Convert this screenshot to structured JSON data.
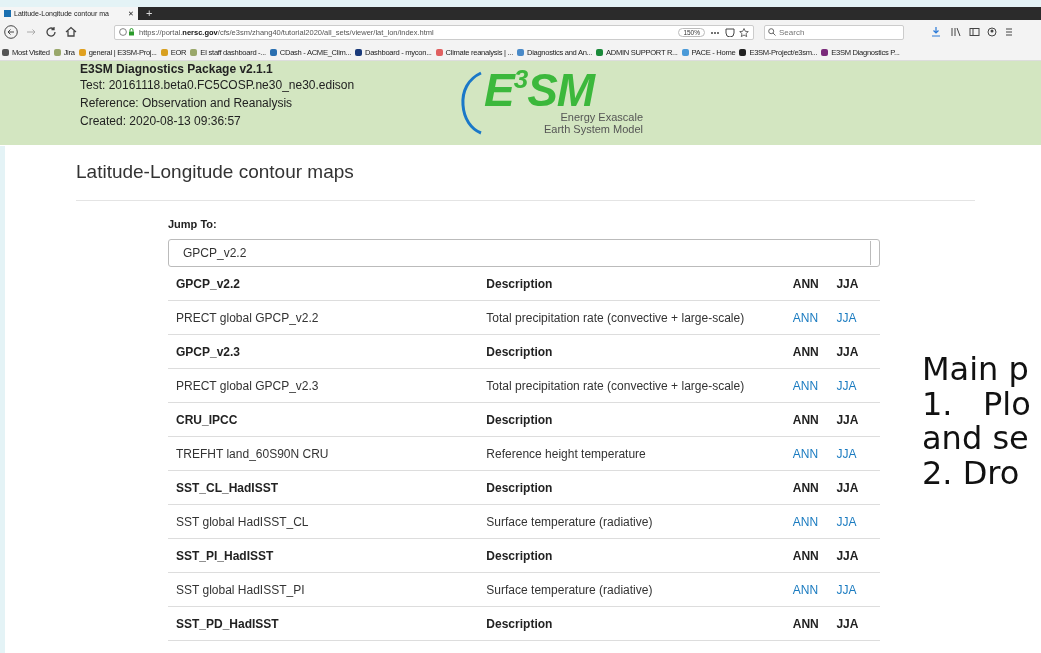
{
  "browser": {
    "tab": {
      "title": "Latitude-Longitude contour ma",
      "close": "✕"
    },
    "new_tab": "+",
    "url": {
      "prefix": "https://portal.",
      "domain": "nersc.gov",
      "path": "/cfs/e3sm/zhang40/tutorial2020/all_sets/viewer/lat_lon/index.html"
    },
    "zoom": "150%",
    "search": {
      "placeholder": "Search"
    },
    "bookmarks": [
      {
        "label": "Most Visited",
        "color": "#555555"
      },
      {
        "label": "Jira",
        "color": "#9aa86b"
      },
      {
        "label": "general | E3SM-Proj...",
        "color": "#e0a020"
      },
      {
        "label": "EOR",
        "color": "#d8a020"
      },
      {
        "label": "EI staff dashboard -...",
        "color": "#9aa86b"
      },
      {
        "label": "CDash - ACME_Clim...",
        "color": "#2a6fb0"
      },
      {
        "label": "Dashboard - mycon...",
        "color": "#1a3a7a"
      },
      {
        "label": "Climate reanalysis | ...",
        "color": "#e06060"
      },
      {
        "label": "Diagnostics and An...",
        "color": "#4a8ac8"
      },
      {
        "label": "ADMIN SUPPORT R...",
        "color": "#1a8a3a"
      },
      {
        "label": "PACE - Home",
        "color": "#4a9ad8"
      },
      {
        "label": "E3SM-Project/e3sm...",
        "color": "#222222"
      },
      {
        "label": "E3SM Diagnostics P...",
        "color": "#7a2a7a"
      }
    ]
  },
  "header": {
    "title": "E3SM Diagnostics Package v2.1.1",
    "lines": [
      "Test: 20161118.beta0.FC5COSP.ne30_ne30.edison",
      "Reference: Observation and Reanalysis",
      "Created: 2020-08-13 09:36:57"
    ],
    "logo": {
      "text": "E",
      "sup": "3",
      "text2": "SM",
      "subtitle": [
        "Energy Exascale",
        "Earth System Model"
      ]
    }
  },
  "page_title": "Latitude-Longitude contour maps",
  "jump_to": {
    "label": "Jump To:",
    "value": "GPCP_v2.2"
  },
  "rows": [
    {
      "kind": "header",
      "name": "GPCP_v2.2",
      "description": "Description",
      "seasons": [
        "ANN",
        "JJA"
      ]
    },
    {
      "kind": "data",
      "name": "PRECT global GPCP_v2.2",
      "description": "Total precipitation rate (convective + large-scale)",
      "seasons": [
        "ANN",
        "JJA"
      ]
    },
    {
      "kind": "header",
      "name": "GPCP_v2.3",
      "description": "Description",
      "seasons": [
        "ANN",
        "JJA"
      ]
    },
    {
      "kind": "data",
      "name": "PRECT global GPCP_v2.3",
      "description": "Total precipitation rate (convective + large-scale)",
      "seasons": [
        "ANN",
        "JJA"
      ]
    },
    {
      "kind": "header",
      "name": "CRU_IPCC",
      "description": "Description",
      "seasons": [
        "ANN",
        "JJA"
      ]
    },
    {
      "kind": "data",
      "name": "TREFHT land_60S90N CRU",
      "description": "Reference height temperature",
      "seasons": [
        "ANN",
        "JJA"
      ]
    },
    {
      "kind": "header",
      "name": "SST_CL_HadISST",
      "description": "Description",
      "seasons": [
        "ANN",
        "JJA"
      ]
    },
    {
      "kind": "data",
      "name": "SST global HadISST_CL",
      "description": "Surface temperature (radiative)",
      "seasons": [
        "ANN",
        "JJA"
      ]
    },
    {
      "kind": "header",
      "name": "SST_PI_HadISST",
      "description": "Description",
      "seasons": [
        "ANN",
        "JJA"
      ]
    },
    {
      "kind": "data",
      "name": "SST global HadISST_PI",
      "description": "Surface temperature (radiative)",
      "seasons": [
        "ANN",
        "JJA"
      ]
    },
    {
      "kind": "header",
      "name": "SST_PD_HadISST",
      "description": "Description",
      "seasons": [
        "ANN",
        "JJA"
      ]
    }
  ],
  "slide_text": [
    "Main p",
    "1.   Plo",
    "and se",
    "2. Dro"
  ]
}
